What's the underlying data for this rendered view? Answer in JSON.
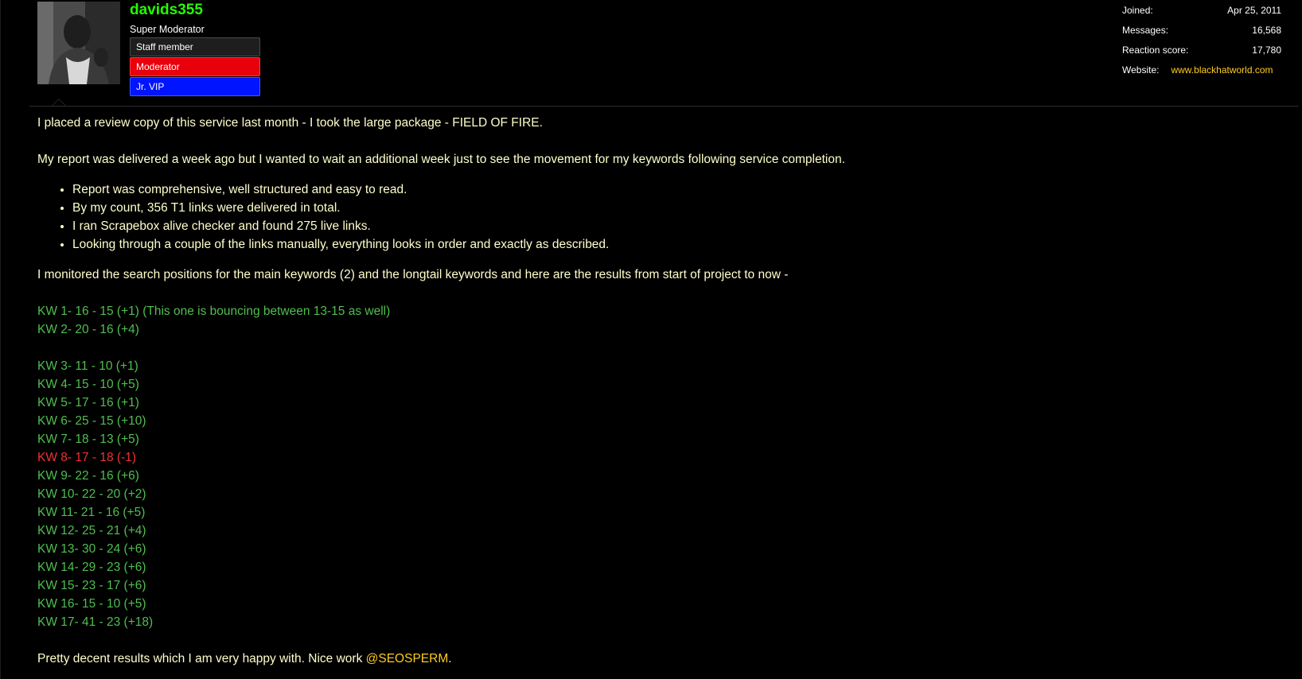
{
  "user": {
    "name": "davids355",
    "title": "Super Moderator",
    "banners": [
      "Staff member",
      "Moderator",
      "Jr. VIP"
    ],
    "stats": {
      "joined_label": "Joined:",
      "joined_value": "Apr 25, 2011",
      "messages_label": "Messages:",
      "messages_value": "16,568",
      "reaction_label": "Reaction score:",
      "reaction_value": "17,780",
      "website_label": "Website:",
      "website_value": "www.blackhatworld.com"
    }
  },
  "colors": {
    "username": "#22ff00",
    "body_text": "#ffffcc",
    "keyword_positive": "#4fbf4f",
    "keyword_negative": "#ee3333",
    "mention": "#ffcc22",
    "moderator_banner": "#e8000a",
    "vip_banner": "#0014ff"
  },
  "post": {
    "intro": "I placed a review copy of this service last month - I took the large package - FIELD OF FIRE.",
    "report": "My report was delivered a week ago but I wanted to wait an additional week just to see the movement for my keywords following service completion.",
    "bullets": [
      "Report was comprehensive, well structured and easy to read.",
      "By my count, 356 T1 links were delivered in total.",
      "I ran Scrapebox alive checker and found 275 live links.",
      "Looking through a couple of the links manually, everything looks in order and exactly as described."
    ],
    "monitor": "I monitored the search positions for the main keywords (2) and the longtail keywords and here are the results from start of project to now -",
    "main_keywords": [
      "KW 1- 16 - 15 (+1) (This one is bouncing between 13-15 as well)",
      "KW 2- 20 - 16 (+4)"
    ],
    "longtail_keywords": [
      "KW 3- 11 - 10 (+1)",
      "KW 4- 15 - 10 (+5)",
      "KW 5- 17 - 16 (+1)",
      "KW 6- 25 - 15 (+10)",
      "KW 7- 18 - 13 (+5)",
      "KW 8- 17 - 18 (-1)",
      "KW 9- 22 - 16 (+6)",
      "KW 10- 22 - 20 (+2)",
      "KW 11- 21 - 16 (+5)",
      "KW 12- 25 - 21 (+4)",
      "KW 13- 30 - 24 (+6)",
      "KW 14- 29 - 23 (+6)",
      "KW 15- 23 - 17 (+6)",
      "KW 16- 15 - 10 (+5)",
      "KW 17- 41 - 23 (+18)"
    ],
    "closing_text": "Pretty decent results which I am very happy with. Nice work ",
    "mention": "@SEOSPERM",
    "closing_end": "."
  }
}
